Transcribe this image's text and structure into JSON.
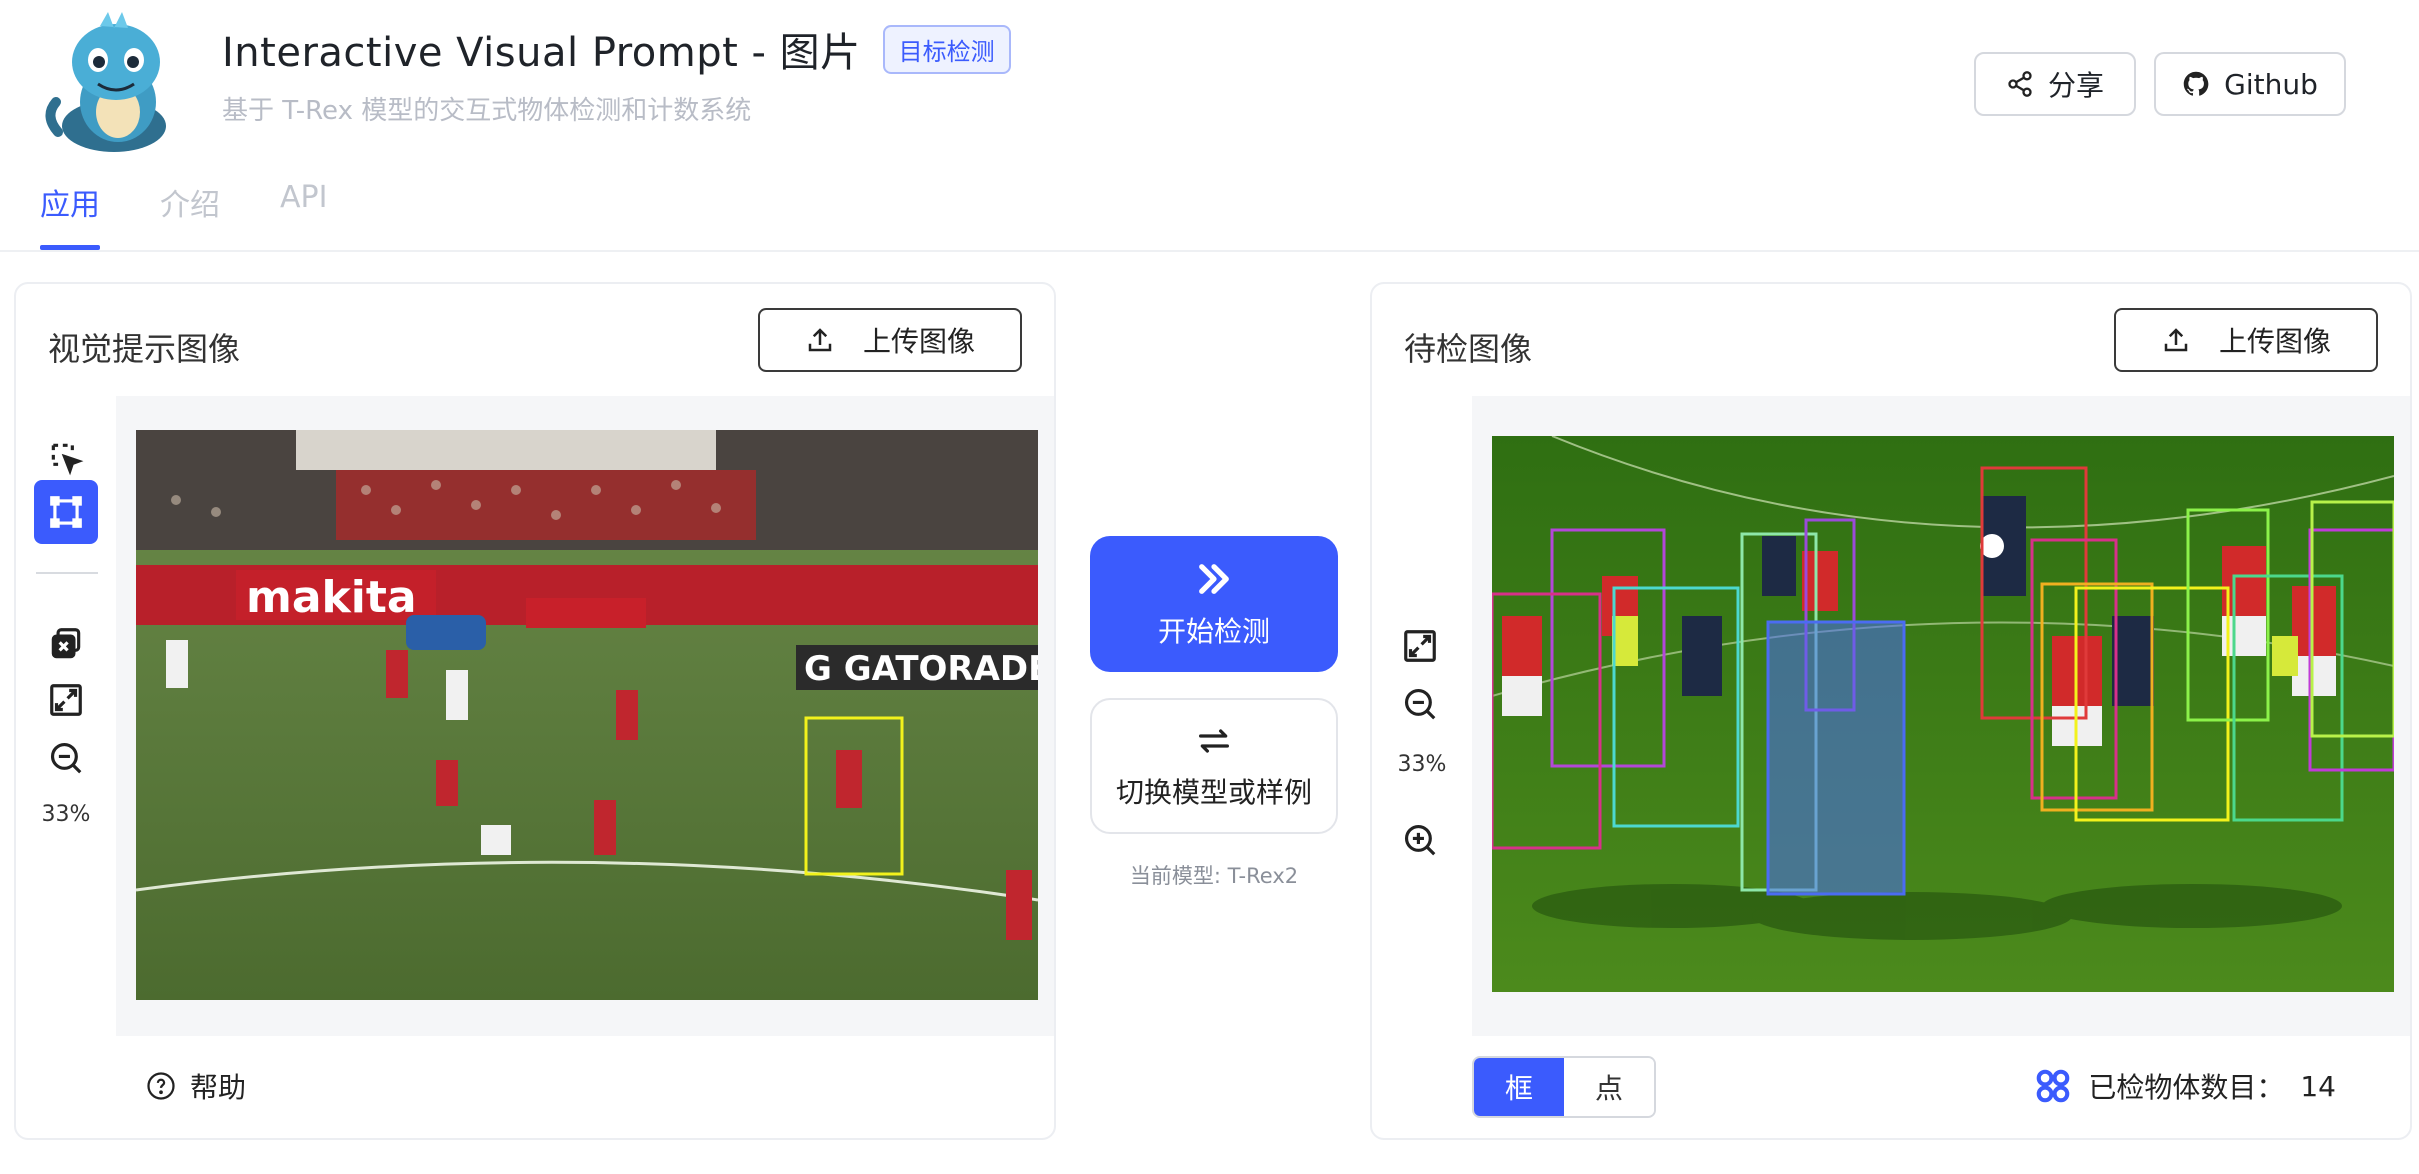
{
  "header": {
    "title": "Interactive Visual Prompt - 图片",
    "tag": "目标检测",
    "subtitle": "基于 T-Rex 模型的交互式物体检测和计数系统",
    "share_label": "分享",
    "github_label": "Github"
  },
  "tabs": [
    {
      "label": "应用",
      "active": true
    },
    {
      "label": "介绍",
      "active": false
    },
    {
      "label": "API",
      "active": false
    }
  ],
  "left_panel": {
    "title": "视觉提示图像",
    "upload_label": "上传图像",
    "zoom": "33%",
    "help_label": "帮助"
  },
  "center": {
    "start_label": "开始检测",
    "switch_label": "切换模型或样例",
    "model_label": "当前模型: T-Rex2"
  },
  "right_panel": {
    "title": "待检图像",
    "upload_label": "上传图像",
    "zoom": "33%",
    "mode_options": [
      "框",
      "点"
    ],
    "mode_selected": "框",
    "count_label": "已检物体数目：",
    "count_value": "14"
  },
  "colors": {
    "accent": "#3b5bfd",
    "prompt_box": "#f2f21c"
  }
}
